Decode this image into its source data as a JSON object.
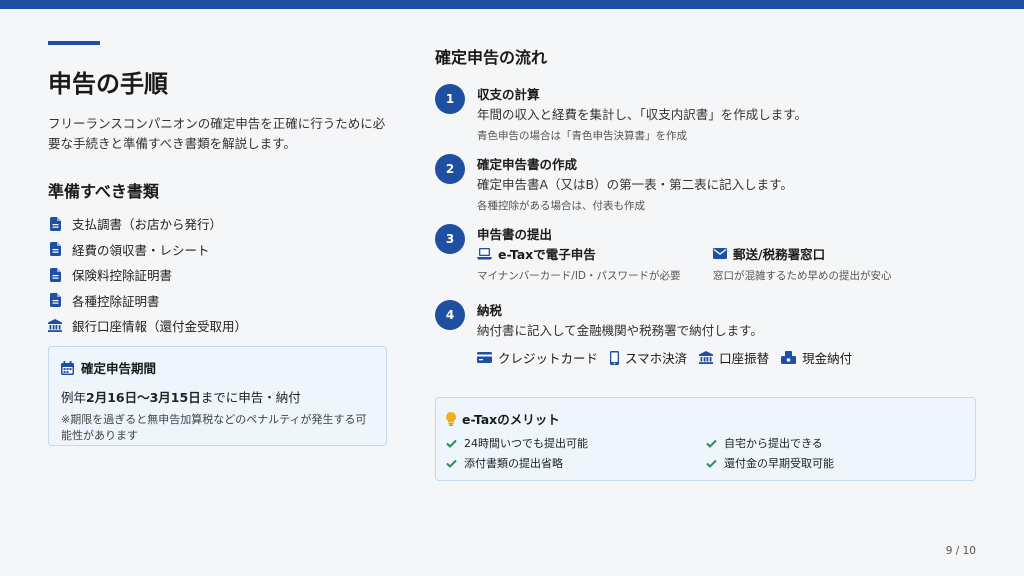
{
  "colors": {
    "accent": "#1f4fa0",
    "check": "#2e8b57",
    "bulb": "#f2b01e",
    "panel_bg": "#eef5fd"
  },
  "title": "申告の手順",
  "intro": "フリーランスコンパニオンの確定申告を正確に行うために必要な手続きと準備すべき書類を解説します。",
  "documents": {
    "heading": "準備すべき書類",
    "items": [
      {
        "icon": "document-icon",
        "label": "支払調書（お店から発行）"
      },
      {
        "icon": "document-icon",
        "label": "経費の領収書・レシート"
      },
      {
        "icon": "document-icon",
        "label": "保険料控除証明書"
      },
      {
        "icon": "document-icon",
        "label": "各種控除証明書"
      },
      {
        "icon": "bank-icon",
        "label": "銀行口座情報（還付金受取用）"
      }
    ]
  },
  "period": {
    "icon": "calendar-icon",
    "heading": "確定申告期間",
    "line_prefix": "例年",
    "line_dates": "2月16日〜3月15日",
    "line_suffix": "までに申告・納付",
    "note": "※期限を過ぎると無申告加算税などのペナルティが発生する可能性があります"
  },
  "flow": {
    "heading": "確定申告の流れ",
    "steps": [
      {
        "num": "1",
        "title": "収支の計算",
        "desc": "年間の収入と経費を集計し、「収支内訳書」を作成します。",
        "note": "青色申告の場合は「青色申告決算書」を作成"
      },
      {
        "num": "2",
        "title": "確定申告書の作成",
        "desc": "確定申告書A（又はB）の第一表・第二表に記入します。",
        "note": "各種控除がある場合は、付表も作成"
      },
      {
        "num": "3",
        "title": "申告書の提出",
        "options": [
          {
            "icon": "laptop-icon",
            "label": "e-Taxで電子申告",
            "note": "マイナンバーカード/ID・パスワードが必要"
          },
          {
            "icon": "mail-icon",
            "label": "郵送/税務署窓口",
            "note": "窓口が混雑するため早めの提出が安心"
          }
        ]
      },
      {
        "num": "4",
        "title": "納税",
        "desc": "納付書に記入して金融機関や税務署で納付します。",
        "payments": [
          {
            "icon": "credit-card-icon",
            "label": "クレジットカード"
          },
          {
            "icon": "smartphone-icon",
            "label": "スマホ決済"
          },
          {
            "icon": "bank-icon",
            "label": "口座振替"
          },
          {
            "icon": "cash-icon",
            "label": "現金納付"
          }
        ]
      }
    ]
  },
  "merit": {
    "icon": "lightbulb-icon",
    "heading": "e-Taxのメリット",
    "items": [
      "24時間いつでも提出可能",
      "自宅から提出できる",
      "添付書類の提出省略",
      "還付金の早期受取可能"
    ]
  },
  "pager": "9 / 10"
}
